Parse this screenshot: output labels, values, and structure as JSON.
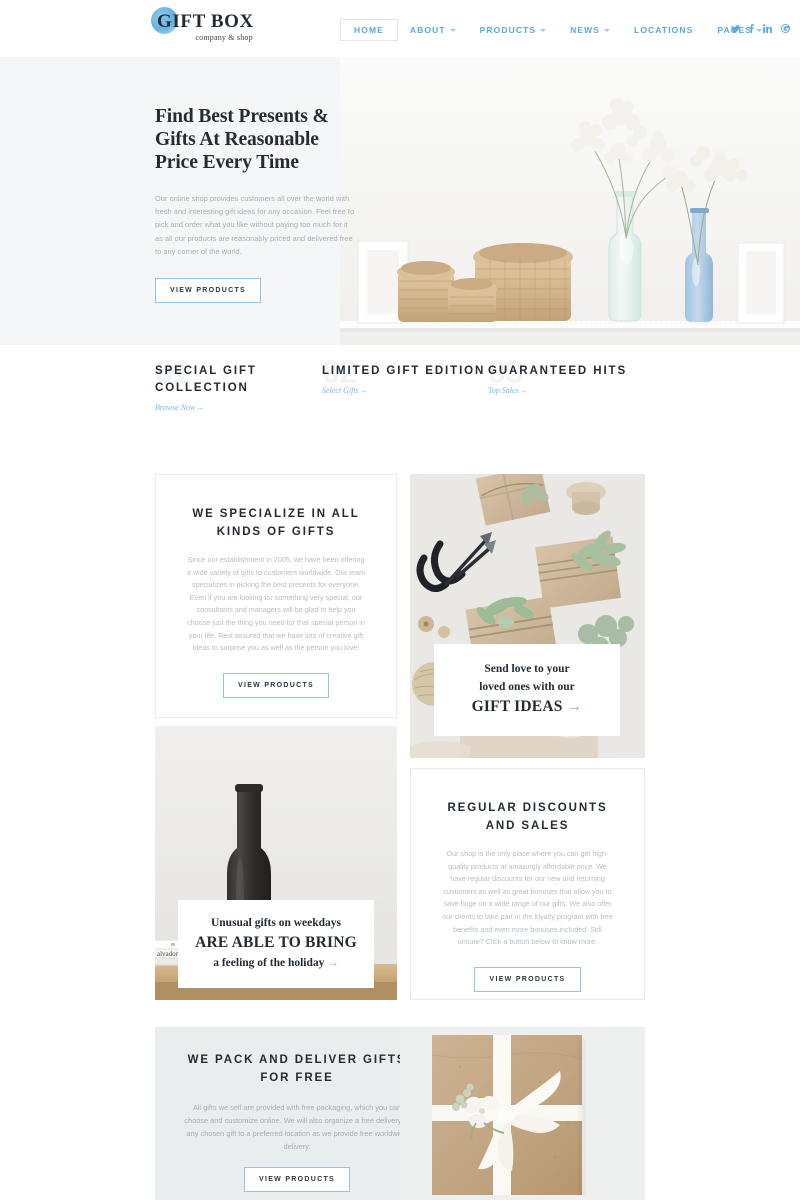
{
  "header": {
    "logo": {
      "main": "GIFT BOX",
      "sub": "company & shop"
    },
    "nav": [
      {
        "label": "HOME",
        "active": true,
        "caret": false
      },
      {
        "label": "ABOUT",
        "active": false,
        "caret": true
      },
      {
        "label": "PRODUCTS",
        "active": false,
        "caret": true
      },
      {
        "label": "NEWS",
        "active": false,
        "caret": true
      },
      {
        "label": "LOCATIONS",
        "active": false,
        "caret": false
      },
      {
        "label": "PAGES",
        "active": false,
        "caret": true
      }
    ],
    "socials": [
      {
        "name": "twitter-icon",
        "glyph": "❧"
      },
      {
        "name": "facebook-icon",
        "glyph": "f"
      },
      {
        "name": "linkedin-icon",
        "glyph": "in"
      },
      {
        "name": "google-plus-icon",
        "glyph": "G"
      }
    ]
  },
  "hero": {
    "title": "Find Best Presents & Gifts At Reasonable Price Every Time",
    "text": "Our online shop provides customers all over the world with fresh and interesting gift ideas for any occasion. Feel free to pick and order what you like without paying too much for it as all our products are reasonably priced and delivered free to any corner of the world.",
    "button": "VIEW PRODUCTS",
    "image_alt": "wicker-baskets-and-glass-vases-on-shelf"
  },
  "features": [
    {
      "number": "01",
      "title": "SPECIAL GIFT COLLECTION",
      "link": "Browse Now"
    },
    {
      "number": "02",
      "title": "LIMITED GIFT EDITION",
      "link": "Select Gifts"
    },
    {
      "number": "03",
      "title": "GUARANTEED HITS",
      "link": "Top Sales"
    }
  ],
  "cards": {
    "specialize": {
      "title": "WE SPECIALIZE IN ALL KINDS OF GIFTS",
      "text": "Since our establishment in 2005, we have been offering a wide variety of gifts to customers worldwide. Our team specializes in picking the best presents for everyone. Even if you are looking for something very special, our consultants and managers will be glad to help you choose just the thing you need for that special person in your life. Rest assured that we have lots of creative gift ideas to surprise you as well as the person you love!",
      "button": "VIEW PRODUCTS"
    },
    "discounts": {
      "title": "REGULAR DISCOUNTS AND SALES",
      "text": "Our shop is the only place where you can get high-quality products at amazingly affordable price. We have regular discounts for our new and returning customers as well as great bonuses that allow you to save huge on a wide range of our gifts. We also offer our clients to take part in the loyalty program with free benefits and even more bonuses included. Still unsure? Click a button below to know more.",
      "button": "VIEW PRODUCTS"
    }
  },
  "overlays": {
    "gift_ideas": {
      "line1": "Send love to your",
      "line2": "loved ones with our",
      "line3": "GIFT IDEAS",
      "arrow": "→",
      "image_alt": "wrapped-gifts-with-scissors-and-greenery"
    },
    "holiday": {
      "line1": "Unusual gifts on weekdays",
      "line2": "ARE ABLE TO BRING",
      "line3": "a feeling of the holiday",
      "arrow": "→",
      "image_alt": "black-vase-and-white-ceramic-on-shelf"
    }
  },
  "banner": {
    "title": "WE PACK AND DELIVER GIFTS FOR FREE",
    "text": "All gifts we sell are provided with free packaging, which you can choose and customize online. We will also organize a free delivery of any chosen gift to a preferred location as we provide free worldwide delivery.",
    "button": "VIEW PRODUCTS",
    "image_alt": "kraft-paper-gift-box-with-white-ribbon-and-flower"
  },
  "colors": {
    "accent": "#5aa8dd",
    "dark": "#232b33",
    "muted": "#b7bdc2",
    "hero_bg": "#f4f6f7",
    "banner_bg": "#e9edee"
  }
}
